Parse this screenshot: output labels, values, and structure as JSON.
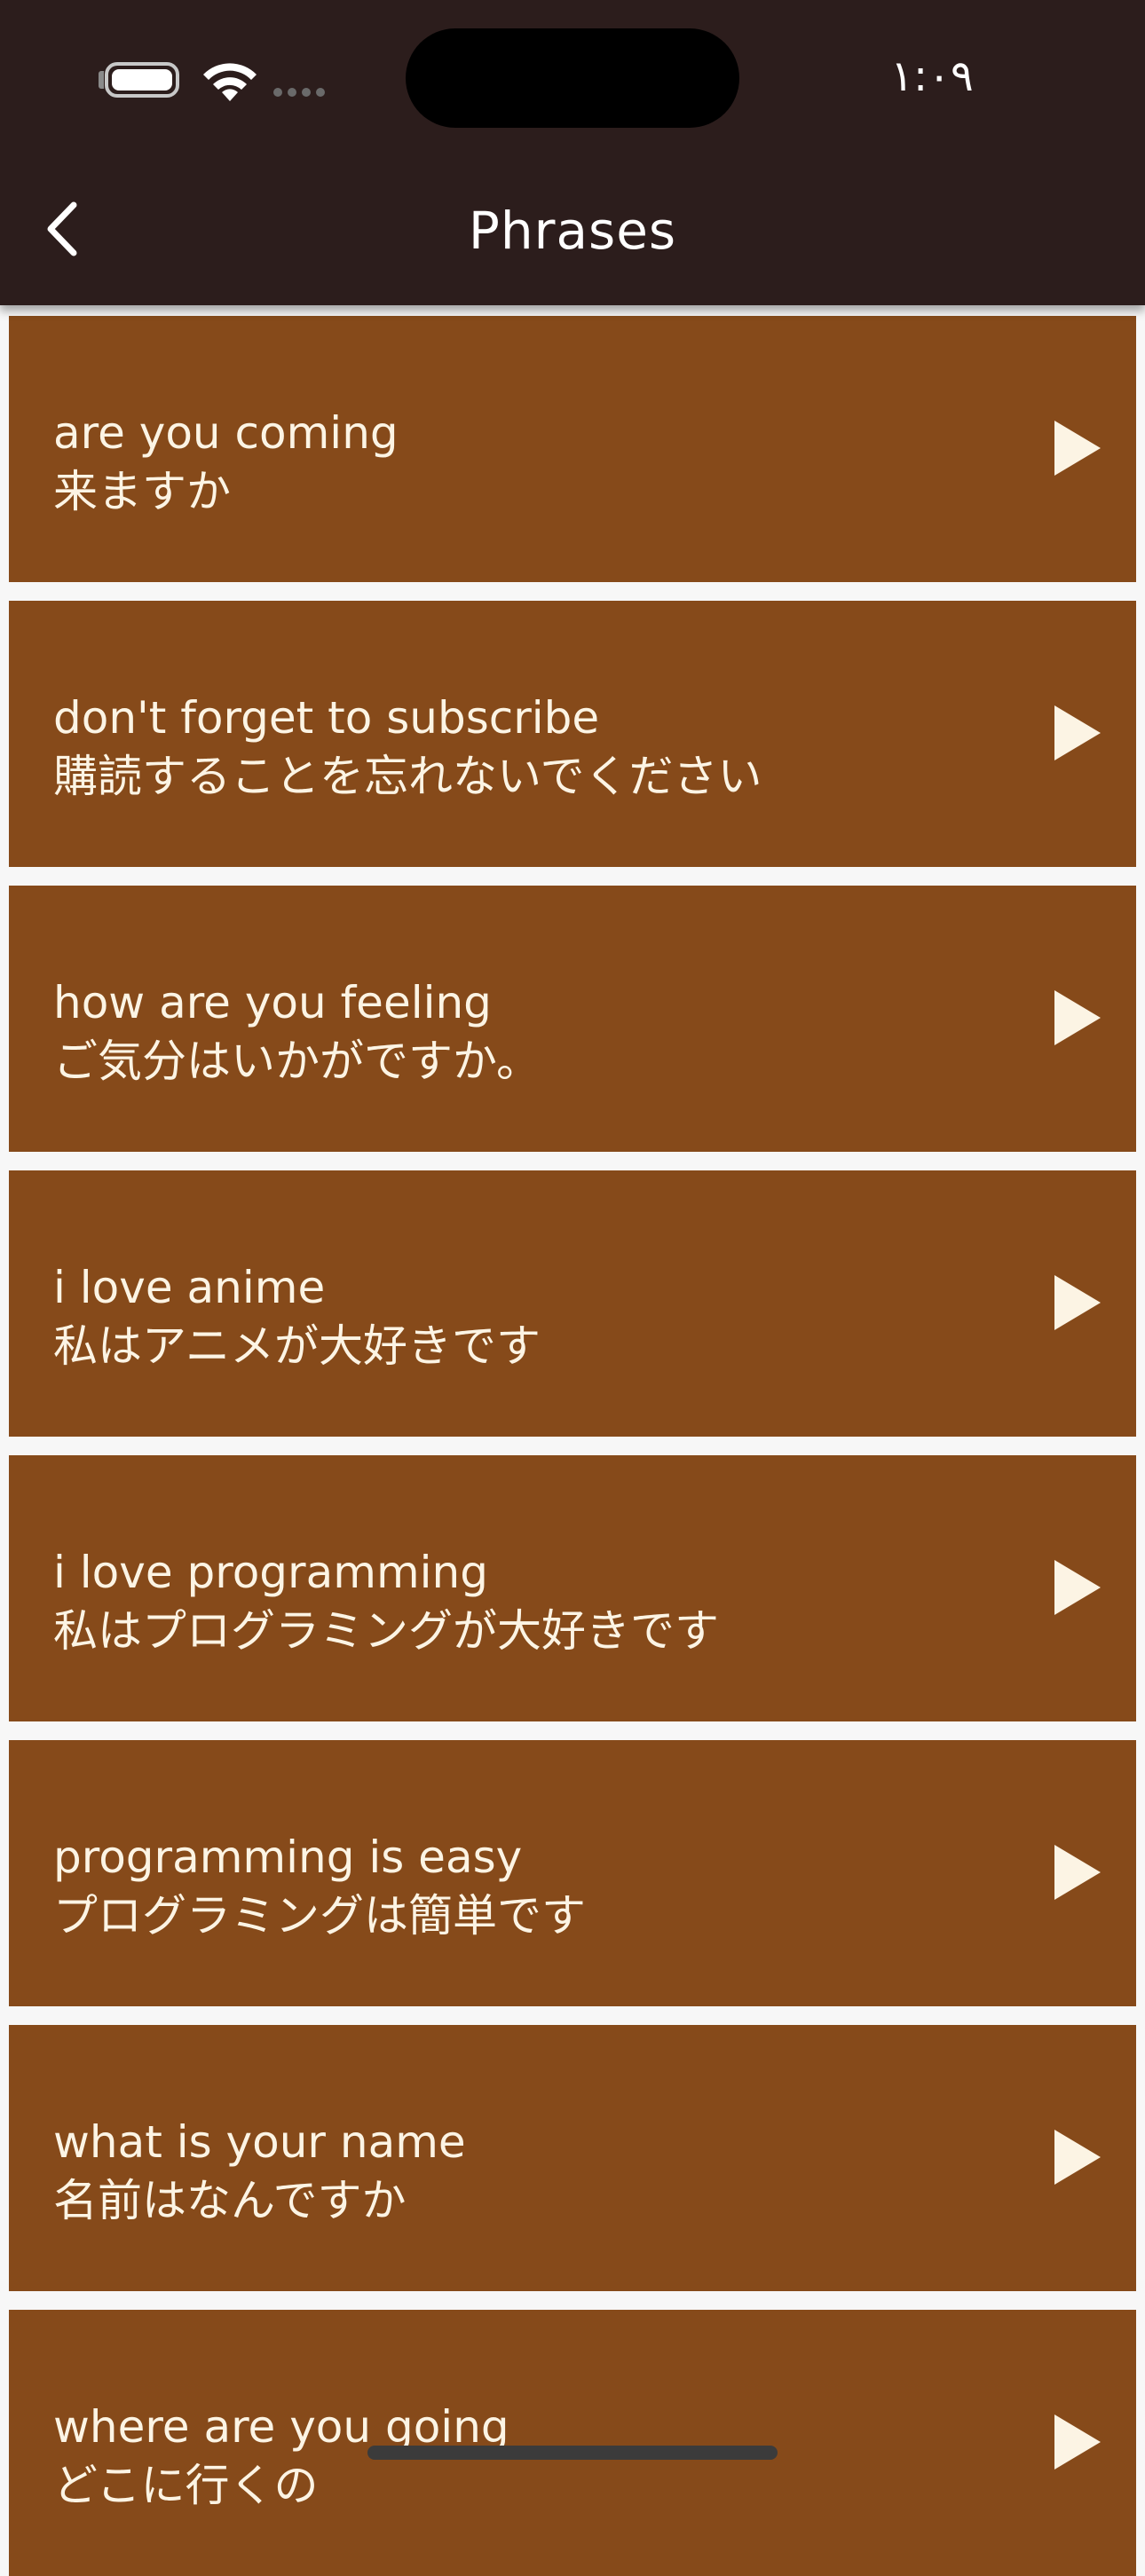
{
  "status_bar": {
    "time": "١:٠٩"
  },
  "header": {
    "title": "Phrases",
    "back_icon": "chevron-left-icon"
  },
  "colors": {
    "header_bg": "#2c1d1c",
    "card_bg": "#864a1a",
    "text": "#fcf4e4",
    "play_icon": "#fcf4e4",
    "divider": "#f7f7f7"
  },
  "phrases": [
    {
      "english": "are you coming",
      "japanese": "来ますか"
    },
    {
      "english": "don't forget to subscribe",
      "japanese": "購読することを忘れないでください"
    },
    {
      "english": "how are you feeling",
      "japanese": "ご気分はいかがですか。"
    },
    {
      "english": "i love anime",
      "japanese": "私はアニメが大好きです"
    },
    {
      "english": "i love programming",
      "japanese": "私はプログラミングが大好きです"
    },
    {
      "english": "programming is easy",
      "japanese": "プログラミングは簡単です"
    },
    {
      "english": "what is your name",
      "japanese": "名前はなんですか"
    },
    {
      "english": "where are you going",
      "japanese": "どこに行くの"
    }
  ]
}
